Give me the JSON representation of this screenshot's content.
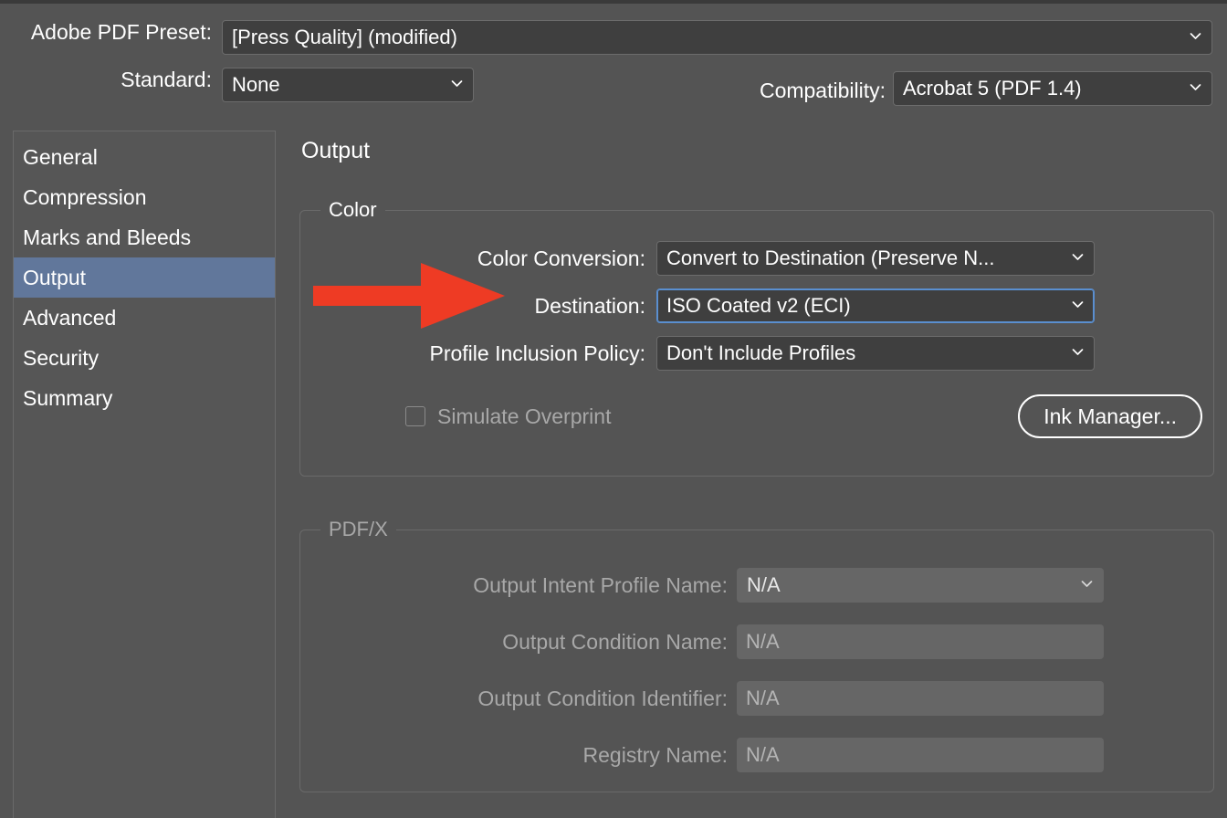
{
  "colors": {
    "background": "#545454",
    "sidebar_bg": "#565656",
    "selection": "#61779b",
    "field_bg": "#3f3f3f",
    "field_border": "#6c6c6c",
    "focus_border": "#5a8fd0",
    "disabled_bg": "#666666",
    "annotation_red": "#ee3b24",
    "text": "#ffffff",
    "text_disabled": "#a8a8a8"
  },
  "header": {
    "preset_label": "Adobe PDF Preset:",
    "preset_value": "[Press Quality] (modified)",
    "standard_label": "Standard:",
    "standard_value": "None",
    "compatibility_label": "Compatibility:",
    "compatibility_value": "Acrobat 5 (PDF 1.4)"
  },
  "sidebar": {
    "items": [
      {
        "label": "General",
        "selected": false
      },
      {
        "label": "Compression",
        "selected": false
      },
      {
        "label": "Marks and Bleeds",
        "selected": false
      },
      {
        "label": "Output",
        "selected": true
      },
      {
        "label": "Advanced",
        "selected": false
      },
      {
        "label": "Security",
        "selected": false
      },
      {
        "label": "Summary",
        "selected": false
      }
    ]
  },
  "panel": {
    "title": "Output",
    "color_group": {
      "legend": "Color",
      "rows": [
        {
          "label": "Color Conversion:",
          "value": "Convert to Destination (Preserve N...",
          "focused": false
        },
        {
          "label": "Destination:",
          "value": "ISO Coated v2 (ECI)",
          "focused": true
        },
        {
          "label": "Profile Inclusion Policy:",
          "value": "Don't Include Profiles",
          "focused": false
        }
      ],
      "simulate_overprint_label": "Simulate Overprint",
      "simulate_overprint_checked": false,
      "ink_manager_label": "Ink Manager..."
    },
    "pdfx_group": {
      "legend": "PDF/X",
      "rows": [
        {
          "label": "Output Intent Profile Name:",
          "value": "N/A",
          "type": "dropdown"
        },
        {
          "label": "Output Condition Name:",
          "value": "N/A",
          "type": "input"
        },
        {
          "label": "Output Condition Identifier:",
          "value": "N/A",
          "type": "input"
        },
        {
          "label": "Registry Name:",
          "value": "N/A",
          "type": "input"
        }
      ]
    }
  },
  "annotation": {
    "type": "red-arrow",
    "points_to": "Destination:",
    "color": "#ee3b24"
  }
}
